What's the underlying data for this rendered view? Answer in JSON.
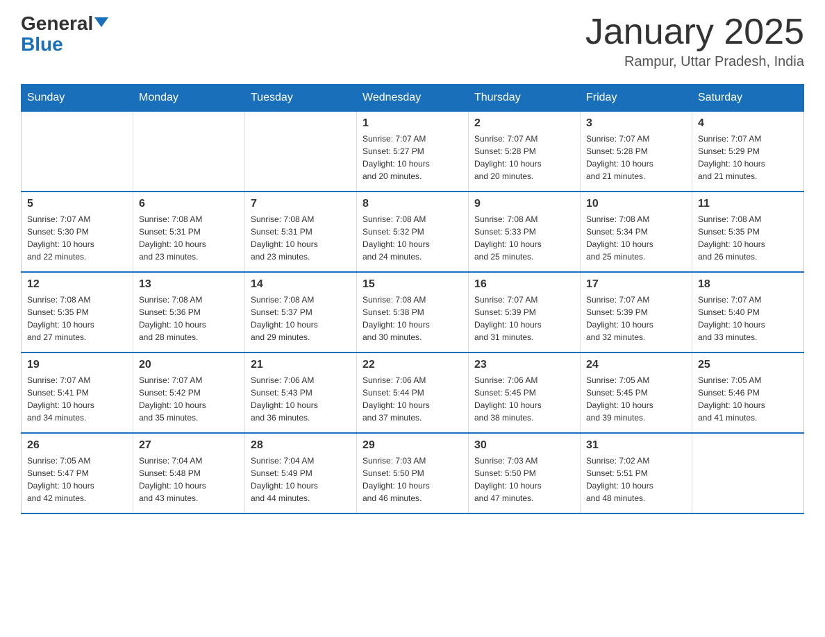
{
  "header": {
    "logo_general": "General",
    "logo_blue": "Blue",
    "month_title": "January 2025",
    "location": "Rampur, Uttar Pradesh, India"
  },
  "days_of_week": [
    "Sunday",
    "Monday",
    "Tuesday",
    "Wednesday",
    "Thursday",
    "Friday",
    "Saturday"
  ],
  "weeks": [
    [
      {
        "day": "",
        "info": ""
      },
      {
        "day": "",
        "info": ""
      },
      {
        "day": "",
        "info": ""
      },
      {
        "day": "1",
        "info": "Sunrise: 7:07 AM\nSunset: 5:27 PM\nDaylight: 10 hours\nand 20 minutes."
      },
      {
        "day": "2",
        "info": "Sunrise: 7:07 AM\nSunset: 5:28 PM\nDaylight: 10 hours\nand 20 minutes."
      },
      {
        "day": "3",
        "info": "Sunrise: 7:07 AM\nSunset: 5:28 PM\nDaylight: 10 hours\nand 21 minutes."
      },
      {
        "day": "4",
        "info": "Sunrise: 7:07 AM\nSunset: 5:29 PM\nDaylight: 10 hours\nand 21 minutes."
      }
    ],
    [
      {
        "day": "5",
        "info": "Sunrise: 7:07 AM\nSunset: 5:30 PM\nDaylight: 10 hours\nand 22 minutes."
      },
      {
        "day": "6",
        "info": "Sunrise: 7:08 AM\nSunset: 5:31 PM\nDaylight: 10 hours\nand 23 minutes."
      },
      {
        "day": "7",
        "info": "Sunrise: 7:08 AM\nSunset: 5:31 PM\nDaylight: 10 hours\nand 23 minutes."
      },
      {
        "day": "8",
        "info": "Sunrise: 7:08 AM\nSunset: 5:32 PM\nDaylight: 10 hours\nand 24 minutes."
      },
      {
        "day": "9",
        "info": "Sunrise: 7:08 AM\nSunset: 5:33 PM\nDaylight: 10 hours\nand 25 minutes."
      },
      {
        "day": "10",
        "info": "Sunrise: 7:08 AM\nSunset: 5:34 PM\nDaylight: 10 hours\nand 25 minutes."
      },
      {
        "day": "11",
        "info": "Sunrise: 7:08 AM\nSunset: 5:35 PM\nDaylight: 10 hours\nand 26 minutes."
      }
    ],
    [
      {
        "day": "12",
        "info": "Sunrise: 7:08 AM\nSunset: 5:35 PM\nDaylight: 10 hours\nand 27 minutes."
      },
      {
        "day": "13",
        "info": "Sunrise: 7:08 AM\nSunset: 5:36 PM\nDaylight: 10 hours\nand 28 minutes."
      },
      {
        "day": "14",
        "info": "Sunrise: 7:08 AM\nSunset: 5:37 PM\nDaylight: 10 hours\nand 29 minutes."
      },
      {
        "day": "15",
        "info": "Sunrise: 7:08 AM\nSunset: 5:38 PM\nDaylight: 10 hours\nand 30 minutes."
      },
      {
        "day": "16",
        "info": "Sunrise: 7:07 AM\nSunset: 5:39 PM\nDaylight: 10 hours\nand 31 minutes."
      },
      {
        "day": "17",
        "info": "Sunrise: 7:07 AM\nSunset: 5:39 PM\nDaylight: 10 hours\nand 32 minutes."
      },
      {
        "day": "18",
        "info": "Sunrise: 7:07 AM\nSunset: 5:40 PM\nDaylight: 10 hours\nand 33 minutes."
      }
    ],
    [
      {
        "day": "19",
        "info": "Sunrise: 7:07 AM\nSunset: 5:41 PM\nDaylight: 10 hours\nand 34 minutes."
      },
      {
        "day": "20",
        "info": "Sunrise: 7:07 AM\nSunset: 5:42 PM\nDaylight: 10 hours\nand 35 minutes."
      },
      {
        "day": "21",
        "info": "Sunrise: 7:06 AM\nSunset: 5:43 PM\nDaylight: 10 hours\nand 36 minutes."
      },
      {
        "day": "22",
        "info": "Sunrise: 7:06 AM\nSunset: 5:44 PM\nDaylight: 10 hours\nand 37 minutes."
      },
      {
        "day": "23",
        "info": "Sunrise: 7:06 AM\nSunset: 5:45 PM\nDaylight: 10 hours\nand 38 minutes."
      },
      {
        "day": "24",
        "info": "Sunrise: 7:05 AM\nSunset: 5:45 PM\nDaylight: 10 hours\nand 39 minutes."
      },
      {
        "day": "25",
        "info": "Sunrise: 7:05 AM\nSunset: 5:46 PM\nDaylight: 10 hours\nand 41 minutes."
      }
    ],
    [
      {
        "day": "26",
        "info": "Sunrise: 7:05 AM\nSunset: 5:47 PM\nDaylight: 10 hours\nand 42 minutes."
      },
      {
        "day": "27",
        "info": "Sunrise: 7:04 AM\nSunset: 5:48 PM\nDaylight: 10 hours\nand 43 minutes."
      },
      {
        "day": "28",
        "info": "Sunrise: 7:04 AM\nSunset: 5:49 PM\nDaylight: 10 hours\nand 44 minutes."
      },
      {
        "day": "29",
        "info": "Sunrise: 7:03 AM\nSunset: 5:50 PM\nDaylight: 10 hours\nand 46 minutes."
      },
      {
        "day": "30",
        "info": "Sunrise: 7:03 AM\nSunset: 5:50 PM\nDaylight: 10 hours\nand 47 minutes."
      },
      {
        "day": "31",
        "info": "Sunrise: 7:02 AM\nSunset: 5:51 PM\nDaylight: 10 hours\nand 48 minutes."
      },
      {
        "day": "",
        "info": ""
      }
    ]
  ]
}
